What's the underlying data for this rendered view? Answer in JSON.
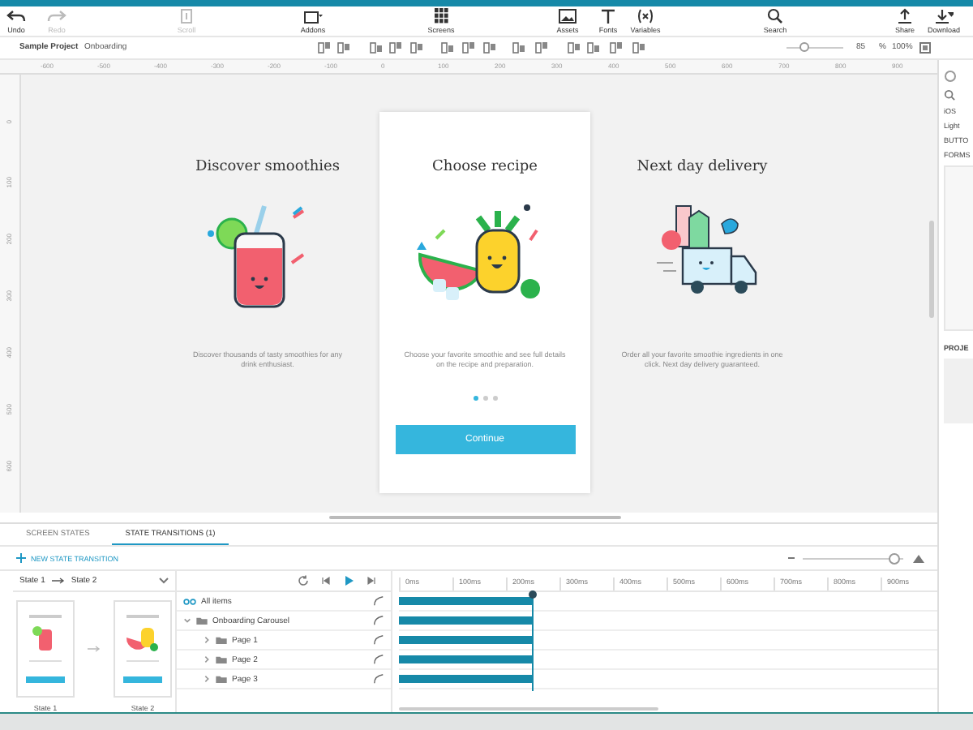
{
  "toolbar": [
    {
      "label": "Undo",
      "disabled": false
    },
    {
      "label": "Redo",
      "disabled": true
    },
    {
      "label": "Scroll",
      "disabled": true
    },
    {
      "label": "Addons",
      "disabled": false
    },
    {
      "label": "Screens",
      "disabled": false
    },
    {
      "label": "Assets",
      "disabled": false
    },
    {
      "label": "Fonts",
      "disabled": false
    },
    {
      "label": "Variables",
      "disabled": false
    },
    {
      "label": "Search",
      "disabled": false
    },
    {
      "label": "Share",
      "disabled": false
    },
    {
      "label": "Download",
      "disabled": false
    }
  ],
  "breadcrumb": [
    "Sample Project",
    "Onboarding"
  ],
  "zoom": {
    "level": 0.3,
    "value": "85",
    "unit": "%",
    "reset": "100%"
  },
  "ruler": [
    "-600",
    "-500",
    "-400",
    "-300",
    "-200",
    "-100",
    "0",
    "100",
    "200",
    "300",
    "400",
    "500",
    "600",
    "700",
    "800",
    "900"
  ],
  "vruler": [
    "0",
    "100",
    "200",
    "300",
    "400",
    "500",
    "600"
  ],
  "pages": [
    {
      "title": "Discover smoothies",
      "text": "Discover thousands of tasty smoothies for any drink enthusiast.",
      "selected": false
    },
    {
      "title": "Choose recipe",
      "text": "Choose your favorite smoothie and see full details on the recipe and preparation.",
      "selected": true
    },
    {
      "title": "Next day delivery",
      "text": "Order all your favorite smoothie ingredients in one click. Next day delivery guaranteed.",
      "selected": false
    }
  ],
  "card": {
    "dots": [
      {
        "selected": true
      },
      {
        "selected": false
      },
      {
        "selected": false
      }
    ],
    "button": "Continue"
  },
  "bottom_tabs": [
    {
      "label": "SCREEN STATES",
      "selected": false
    },
    {
      "label": "STATE TRANSITIONS (1)",
      "selected": true
    }
  ],
  "new_transition": "NEW STATE TRANSITION",
  "timeline_zoom": {
    "level": 0.9
  },
  "transition": {
    "from": "State 1",
    "to": "State 2"
  },
  "states": [
    {
      "label": "State 1"
    },
    {
      "label": "State 2"
    }
  ],
  "layers": [
    {
      "label": "All items",
      "kind": "all",
      "level": 0.25
    },
    {
      "label": "Onboarding Carousel",
      "kind": "group",
      "expanded": true,
      "level": 0.25,
      "children": [
        {
          "label": "Page 1",
          "kind": "group",
          "expanded": false,
          "level": 0.25
        },
        {
          "label": "Page 2",
          "kind": "group",
          "expanded": false,
          "level": 0.25
        },
        {
          "label": "Page 3",
          "kind": "group",
          "expanded": false,
          "level": 0.25
        }
      ]
    }
  ],
  "timeline": {
    "ticks": [
      "0ms",
      "100ms",
      "200ms",
      "300ms",
      "400ms",
      "500ms",
      "600ms",
      "700ms",
      "800ms",
      "900ms"
    ]
  },
  "right_panel": {
    "items": [
      "iOS",
      "Light",
      "BUTTO",
      "FORMS"
    ],
    "section": "PROJE"
  }
}
